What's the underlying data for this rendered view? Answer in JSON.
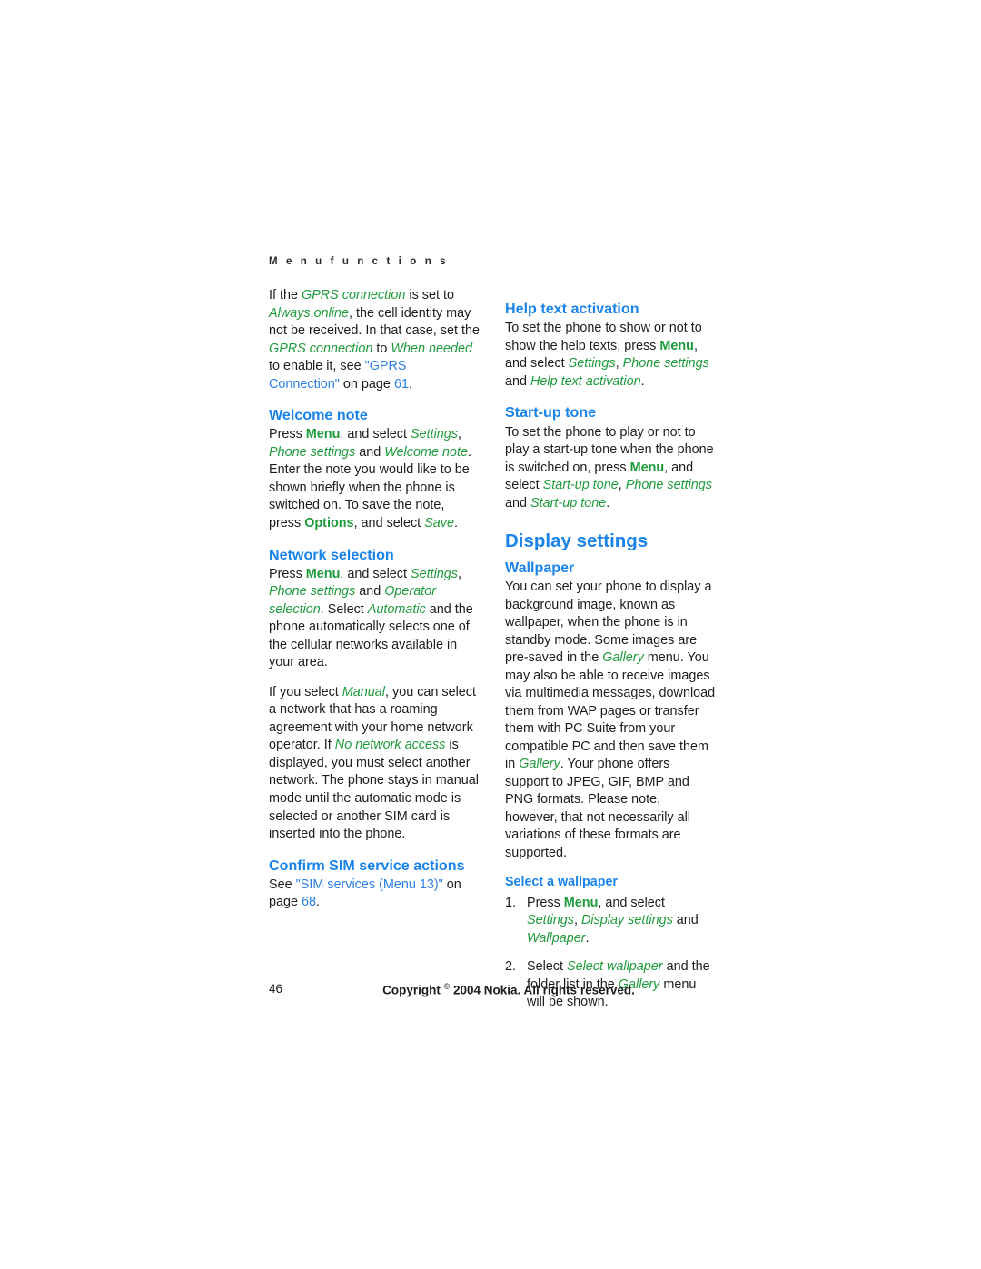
{
  "page": {
    "running_head": "M e n u   f u n c t i o n s",
    "folio": "46",
    "copyright_prefix": "Copyright ",
    "copyright_symbol": "©",
    "copyright_suffix": " 2004 Nokia. All rights reserved."
  },
  "colors": {
    "heading_blue": "#1a84e8",
    "ui_term_green": "#1e9b3c",
    "cross_reference_blue": "#2a7fe0",
    "body_text": "#1d1d1d",
    "page_background": "#ffffff"
  },
  "left_column": {
    "intro_paragraph": {
      "t1": "If the ",
      "em1": "GPRS connection",
      "t2": " is set to ",
      "em2": "Always online",
      "t3": ", the cell identity may not be received. In that case, set the ",
      "em3": "GPRS connection",
      "t4": " to ",
      "em4": "When needed",
      "t5": " to enable it, see ",
      "xref1": "\"GPRS Connection\"",
      "t6": " on page ",
      "xref2": "61",
      "t7": "."
    },
    "welcome_note": {
      "heading": "Welcome note",
      "body": {
        "t1": "Press ",
        "kw1": "Menu",
        "t2": ", and select ",
        "em1": "Settings",
        "t3": ", ",
        "em2": "Phone settings",
        "t4": " and ",
        "em3": "Welcome note",
        "t5": ". Enter the note you would like to be shown briefly when the phone is switched on. To save the note, press ",
        "kw2": "Options",
        "t6": ", and select ",
        "em4": "Save",
        "t7": "."
      }
    },
    "network_selection": {
      "heading": "Network selection",
      "para1": {
        "t1": "Press ",
        "kw1": "Menu",
        "t2": ", and select ",
        "em1": "Settings",
        "t3": ", ",
        "em2": "Phone settings",
        "t4": " and ",
        "em3": "Operator selection",
        "t5": ". Select ",
        "em4": "Automatic",
        "t6": " and the phone automatically selects one of the cellular networks available in your area."
      },
      "para2": {
        "t1": "If you select ",
        "em1": "Manual",
        "t2": ", you can select a network that has a roaming agreement with your home network operator. If ",
        "em2": "No network access",
        "t3": " is displayed, you must select another network. The phone stays in manual mode until the automatic mode is selected or another SIM card is inserted into the phone."
      }
    },
    "confirm_sim": {
      "heading": "Confirm SIM service actions",
      "body": {
        "t1": "See ",
        "xref1": "\"SIM services (Menu 13)\"",
        "t2": " on page ",
        "xref2": "68",
        "t3": "."
      }
    }
  },
  "right_column": {
    "help_text_activation": {
      "heading": "Help text activation",
      "body": {
        "t1": "To set the phone to show or not to show the help texts, press ",
        "kw1": "Menu",
        "t2": ", and select ",
        "em1": "Settings",
        "t3": ", ",
        "em2": "Phone settings",
        "t4": " and ",
        "em3": "Help text activation",
        "t5": "."
      }
    },
    "start_up_tone": {
      "heading": "Start-up tone",
      "body": {
        "t1": "To set the phone to play or not to play a start-up tone when the phone is switched on, press ",
        "kw1": "Menu",
        "t2": ", and select ",
        "em1": "Start-up tone",
        "t3": ", ",
        "em2": "Phone settings",
        "t4": " and ",
        "em3": "Start-up tone",
        "t5": "."
      }
    },
    "display_settings": {
      "heading": "Display settings"
    },
    "wallpaper": {
      "heading": "Wallpaper",
      "body": {
        "t1": "You can set your phone to display a background image, known as wallpaper, when the phone is in standby mode. Some images are pre-saved in the ",
        "em1": "Gallery",
        "t2": " menu. You may also be able to receive images via multimedia messages, download them from WAP pages or transfer them with PC Suite from your compatible PC and then save them in ",
        "em2": "Gallery",
        "t3": ". Your phone offers support to JPEG, GIF, BMP and PNG formats. Please note, however, that not necessarily all variations of these formats are supported."
      }
    },
    "select_a_wallpaper": {
      "heading": "Select a wallpaper",
      "steps": [
        {
          "num": "1.",
          "t1": "Press ",
          "kw1": "Menu",
          "t2": ", and select ",
          "em1": "Settings",
          "t3": ", ",
          "em2": "Display settings",
          "t4": " and ",
          "em3": "Wallpaper",
          "t5": "."
        },
        {
          "num": "2.",
          "t1": "Select ",
          "em1": "Select wallpaper",
          "t2": " and the folder list in the ",
          "em2": "Gallery",
          "t3": " menu will be shown."
        }
      ]
    }
  }
}
